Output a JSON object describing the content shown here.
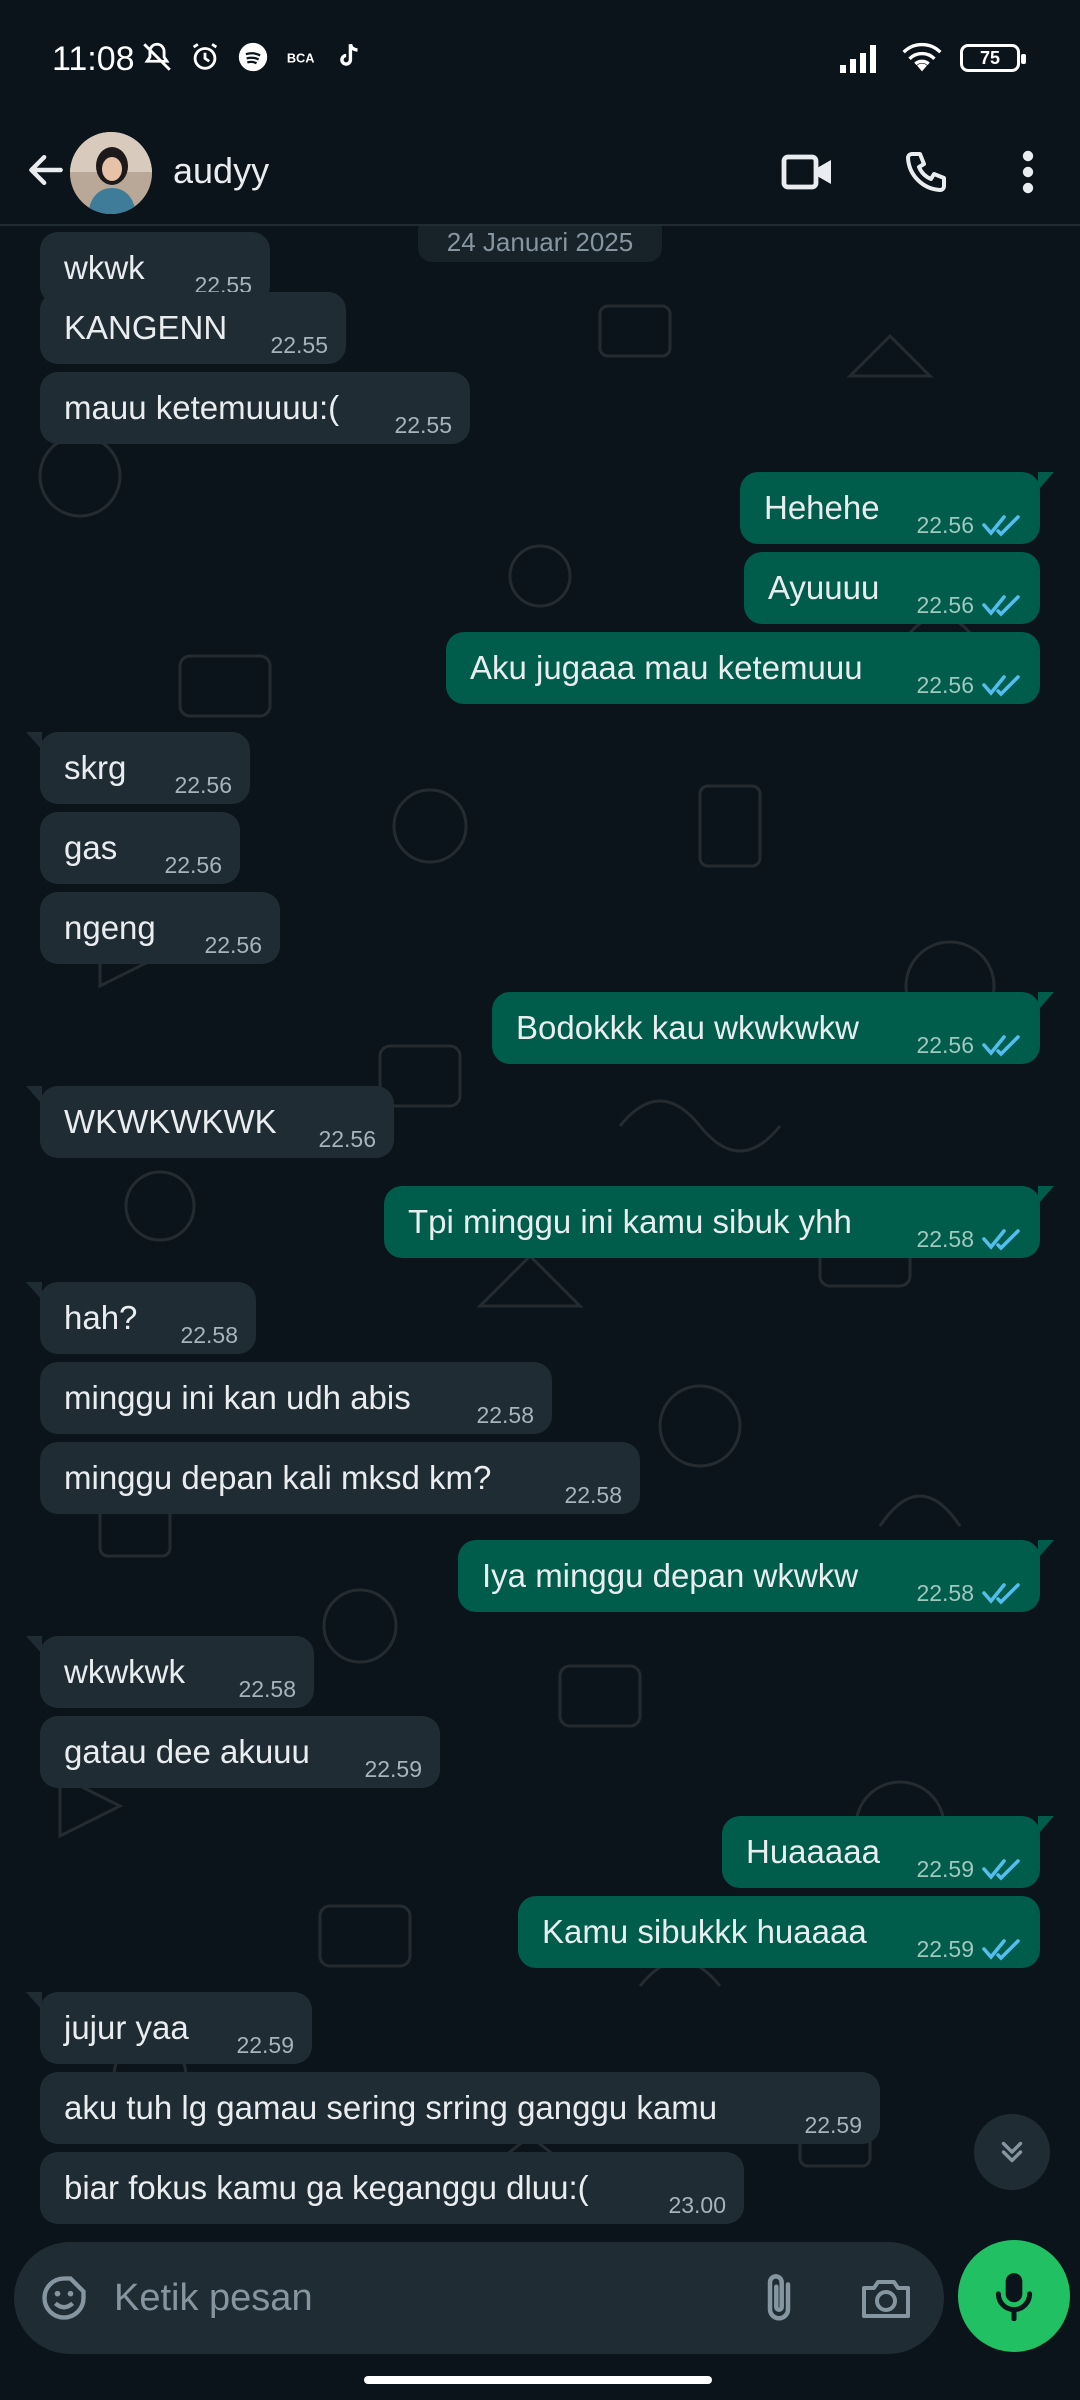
{
  "status_bar": {
    "time": "11:08",
    "battery": "75"
  },
  "header": {
    "contact_name": "audyy"
  },
  "chat": {
    "date_chip": "24 Januari 2025",
    "messages": [
      {
        "text": "wkwk",
        "time": "22.55"
      },
      {
        "text": "KANGENN",
        "time": "22.55"
      },
      {
        "text": "mauu ketemuuuu:(",
        "time": "22.55"
      },
      {
        "text": "Hehehe",
        "time": "22.56"
      },
      {
        "text": "Ayuuuu",
        "time": "22.56"
      },
      {
        "text": "Aku jugaaa mau ketemuuu",
        "time": "22.56"
      },
      {
        "text": "skrg",
        "time": "22.56"
      },
      {
        "text": "gas",
        "time": "22.56"
      },
      {
        "text": "ngeng",
        "time": "22.56"
      },
      {
        "text": "Bodokkk kau wkwkwkw",
        "time": "22.56"
      },
      {
        "text": "WKWKWKWK",
        "time": "22.56"
      },
      {
        "text": "Tpi minggu ini kamu sibuk yhh",
        "time": "22.58"
      },
      {
        "text": "hah?",
        "time": "22.58"
      },
      {
        "text": "minggu ini kan udh abis",
        "time": "22.58"
      },
      {
        "text": "minggu depan kali mksd km?",
        "time": "22.58"
      },
      {
        "text": "Iya minggu depan wkwkw",
        "time": "22.58"
      },
      {
        "text": "wkwkwk",
        "time": "22.58"
      },
      {
        "text": "gatau dee akuuu",
        "time": "22.59"
      },
      {
        "text": "Huaaaaa",
        "time": "22.59"
      },
      {
        "text": "Kamu sibukkk huaaaa",
        "time": "22.59"
      },
      {
        "text": "jujur yaa",
        "time": "22.59"
      },
      {
        "text": "aku tuh lg gamau sering srring ganggu kamu",
        "time": "22.59"
      },
      {
        "text": "biar fokus kamu ga keganggu dluu:(",
        "time": "23.00"
      }
    ]
  },
  "input": {
    "placeholder": "Ketik pesan"
  },
  "colors": {
    "background": "#0b141a",
    "incoming_bubble": "#202c33",
    "outgoing_bubble": "#005c4b",
    "read_ticks": "#53bdeb",
    "mic_button": "#21c063"
  }
}
